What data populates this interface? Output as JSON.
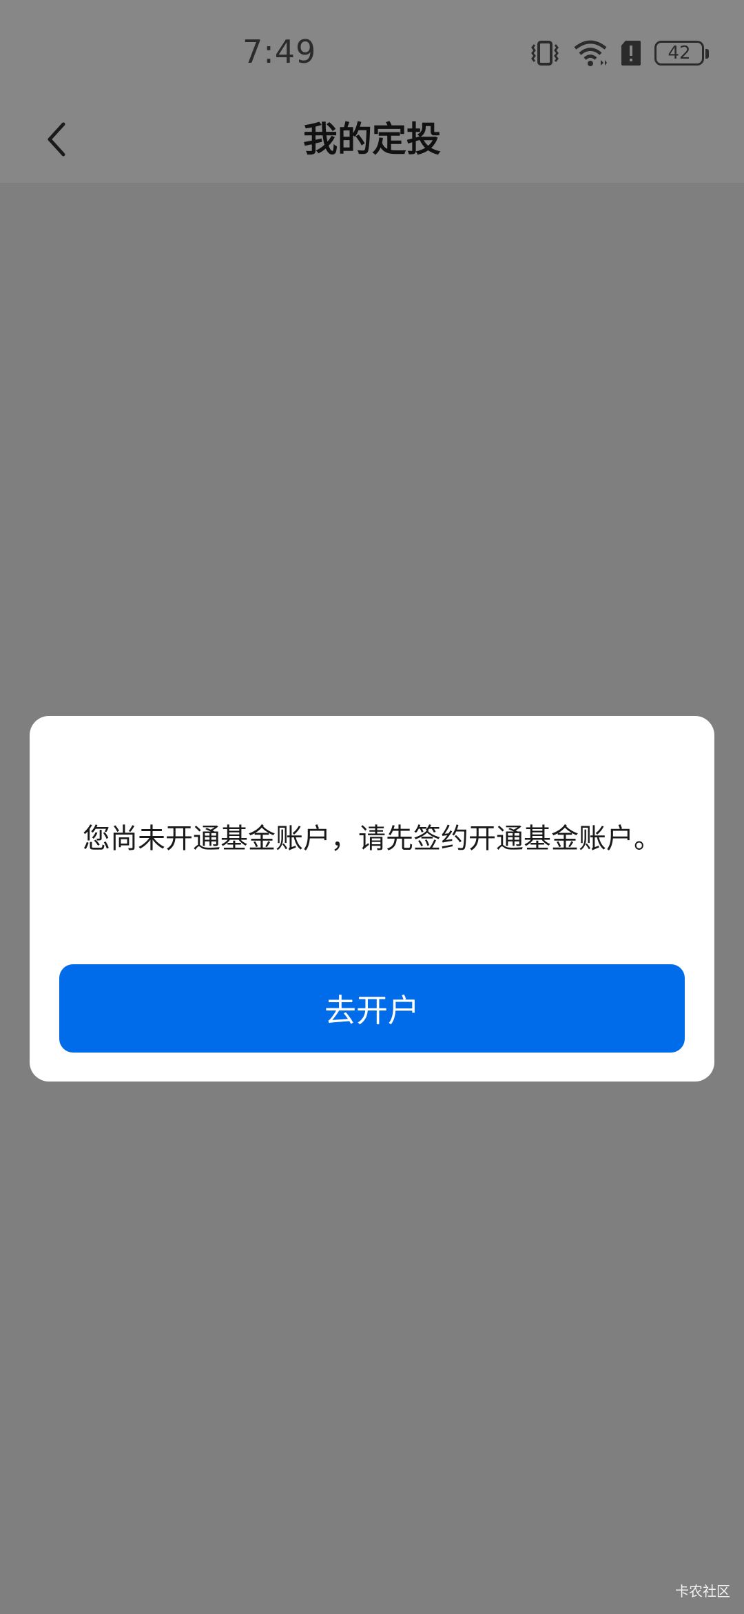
{
  "status_bar": {
    "time": "7:49",
    "battery_level": "42",
    "icons": [
      "vibrate-icon",
      "wifi-icon",
      "sim-alert-icon",
      "battery-icon"
    ]
  },
  "app_bar": {
    "title": "我的定投",
    "back_icon": "chevron-left-icon"
  },
  "dialog": {
    "message": "您尚未开通基金账户，请先签约开通基金账户。",
    "button_label": "去开户",
    "button_color": "#006ce9"
  },
  "watermark": "卡农社区",
  "colors": {
    "scrim": "#7f7f7f",
    "dialog_bg": "#ffffff",
    "accent": "#006ce9"
  }
}
